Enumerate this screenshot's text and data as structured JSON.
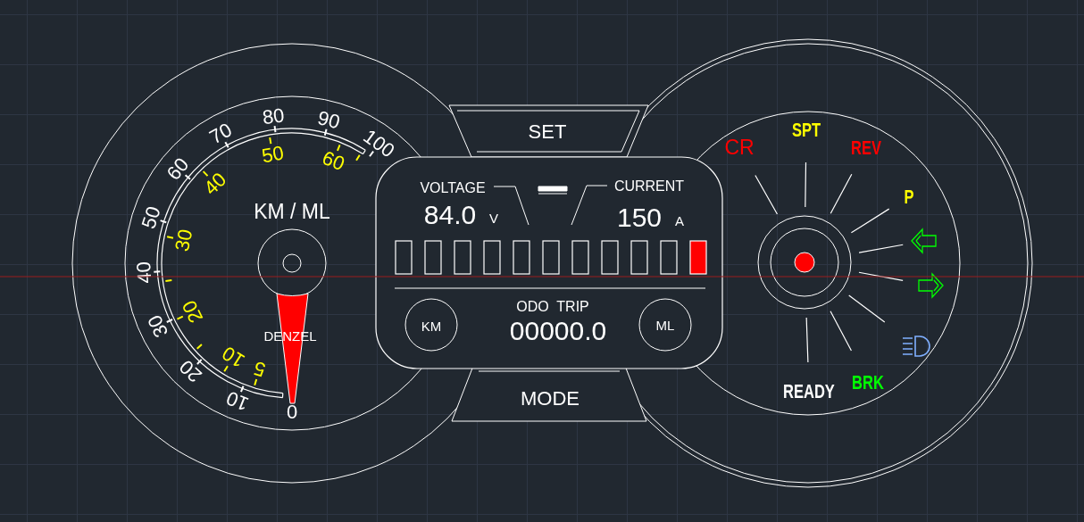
{
  "left_gauge": {
    "outer_scale": [
      "0",
      "10",
      "20",
      "30",
      "40",
      "50",
      "60",
      "70",
      "80",
      "90",
      "100"
    ],
    "inner_scale": [
      "5",
      "10",
      "20",
      "30",
      "40",
      "50",
      "60"
    ],
    "unit": "KM / ML",
    "brand": "DENZEL"
  },
  "buttons": {
    "top": "SET",
    "bottom": "MODE"
  },
  "display": {
    "voltage_label": "VOLTAGE",
    "voltage": "84.0",
    "voltage_unit": "V",
    "current_label": "CURRENT",
    "current": "150",
    "current_unit": "A",
    "segments": [
      {
        "lit": false
      },
      {
        "lit": false
      },
      {
        "lit": false
      },
      {
        "lit": false
      },
      {
        "lit": false
      },
      {
        "lit": false
      },
      {
        "lit": false
      },
      {
        "lit": false
      },
      {
        "lit": false
      },
      {
        "lit": false
      },
      {
        "lit": true
      }
    ],
    "trip_label": "ODO  TRIP",
    "odometer": "00000.0",
    "left_button": "KM",
    "right_button": "ML"
  },
  "indicators": [
    {
      "kind": "text",
      "label": "CR",
      "color": "#ff0000",
      "outline": false
    },
    {
      "kind": "text",
      "label": "SPT",
      "color": "#ffff00",
      "outline": true
    },
    {
      "kind": "text",
      "label": "REV",
      "color": "#ff0000",
      "outline": true
    },
    {
      "kind": "text",
      "label": "P",
      "color": "#ffff00",
      "outline": true
    },
    {
      "kind": "arrow-left",
      "color": "#00ff00"
    },
    {
      "kind": "arrow-right",
      "color": "#00ff00"
    },
    {
      "kind": "headlight",
      "color": "#80b0ff"
    },
    {
      "kind": "text",
      "label": "BRK",
      "color": "#00ff00",
      "outline": true
    },
    {
      "kind": "text",
      "label": "READY",
      "color": "#ffffff",
      "outline": true
    }
  ]
}
